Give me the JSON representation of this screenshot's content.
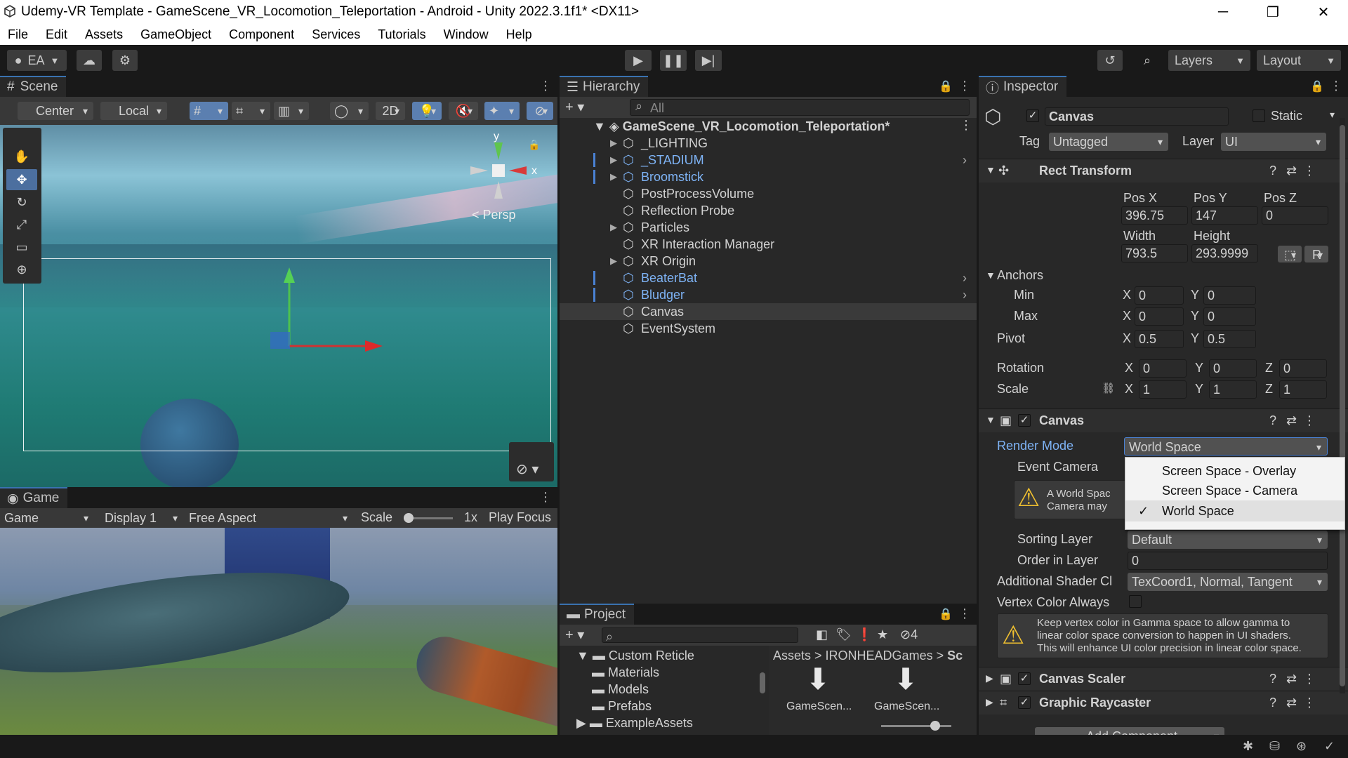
{
  "window": {
    "title": "Udemy-VR Template - GameScene_VR_Locomotion_Teleportation - Android - Unity 2022.3.1f1* <DX11>",
    "minimize": "─",
    "maximize": "❐",
    "close": "✕"
  },
  "menu": [
    "File",
    "Edit",
    "Assets",
    "GameObject",
    "Component",
    "Services",
    "Tutorials",
    "Window",
    "Help"
  ],
  "toolbar": {
    "account": "EA",
    "layers": "Layers",
    "layout": "Layout"
  },
  "scene": {
    "tab": "Scene",
    "pivot": "Center",
    "space": "Local",
    "mode2d": "2D",
    "persp": "< Persp",
    "axis_x": "x",
    "axis_y": "y"
  },
  "game": {
    "tab": "Game",
    "view": "Game",
    "display": "Display 1",
    "aspect": "Free Aspect",
    "scale_label": "Scale",
    "scale_value": "1x",
    "play_focus": "Play Focus"
  },
  "hierarchy": {
    "tab": "Hierarchy",
    "search_placeholder": "All",
    "scene_name": "GameScene_VR_Locomotion_Teleportation*",
    "items": [
      {
        "label": "_LIGHTING",
        "prefab": false,
        "arrow": true
      },
      {
        "label": "_STADIUM",
        "prefab": true,
        "arrow": true
      },
      {
        "label": "Broomstick",
        "prefab": true,
        "arrow": true
      },
      {
        "label": "PostProcessVolume",
        "prefab": false,
        "arrow": false
      },
      {
        "label": "Reflection Probe",
        "prefab": false,
        "arrow": false
      },
      {
        "label": "Particles",
        "prefab": false,
        "arrow": true
      },
      {
        "label": "XR Interaction Manager",
        "prefab": false,
        "arrow": false
      },
      {
        "label": "XR Origin",
        "prefab": false,
        "arrow": true
      },
      {
        "label": "BeaterBat",
        "prefab": true,
        "arrow": false
      },
      {
        "label": "Bludger",
        "prefab": true,
        "arrow": false
      },
      {
        "label": "Canvas",
        "prefab": false,
        "arrow": false,
        "selected": true
      },
      {
        "label": "EventSystem",
        "prefab": false,
        "arrow": false
      }
    ]
  },
  "project": {
    "tab": "Project",
    "hidden_count": "4",
    "tree": [
      {
        "label": "Custom Reticle",
        "indent": 0
      },
      {
        "label": "Materials",
        "indent": 1
      },
      {
        "label": "Models",
        "indent": 1
      },
      {
        "label": "Prefabs",
        "indent": 1
      },
      {
        "label": "ExampleAssets",
        "indent": 0
      },
      {
        "label": "IRONHEADGames",
        "indent": 0
      }
    ],
    "breadcrumb": [
      "Assets",
      "IRONHEADGames",
      "Sc"
    ],
    "assets": [
      "GameScen...",
      "GameScen..."
    ]
  },
  "inspector": {
    "tab": "Inspector",
    "object_name": "Canvas",
    "static_label": "Static",
    "tag_label": "Tag",
    "tag_value": "Untagged",
    "layer_label": "Layer",
    "layer_value": "UI",
    "rect": {
      "title": "Rect Transform",
      "posx_label": "Pos X",
      "posy_label": "Pos Y",
      "posz_label": "Pos Z",
      "posx": "396.75",
      "posy": "147",
      "posz": "0",
      "width_label": "Width",
      "height_label": "Height",
      "width": "793.5",
      "height": "293.9999",
      "r_btn": "R",
      "anchors": "Anchors",
      "min": "Min",
      "max": "Max",
      "pivot": "Pivot",
      "rotation": "Rotation",
      "scale": "Scale",
      "x": "X",
      "y": "Y",
      "z": "Z",
      "min_x": "0",
      "min_y": "0",
      "max_x": "0",
      "max_y": "0",
      "pivot_x": "0.5",
      "pivot_y": "0.5",
      "rot_x": "0",
      "rot_y": "0",
      "rot_z": "0",
      "scale_x": "1",
      "scale_y": "1",
      "scale_z": "1"
    },
    "canvas": {
      "title": "Canvas",
      "render_mode_label": "Render Mode",
      "render_mode": "World Space",
      "event_camera": "Event Camera",
      "warn1_line1": "A World Spac",
      "warn1_line2": "Camera may",
      "sorting_layer_label": "Sorting Layer",
      "sorting_layer": "Default",
      "order_label": "Order in Layer",
      "order": "0",
      "shader_label": "Additional Shader Cl",
      "shader_value": "TexCoord1, Normal, Tangent",
      "vertex_label": "Vertex Color Always",
      "warn2": [
        "Keep vertex color in Gamma space to allow gamma to",
        "linear color space conversion to happen in UI shaders.",
        "This will enhance UI color precision in linear color space."
      ]
    },
    "dropdown": {
      "options": [
        "Screen Space - Overlay",
        "Screen Space - Camera",
        "World Space"
      ],
      "selected": "World Space",
      "check": "✓"
    },
    "scaler": "Canvas Scaler",
    "raycaster": "Graphic Raycaster",
    "add_component": "Add Component"
  }
}
